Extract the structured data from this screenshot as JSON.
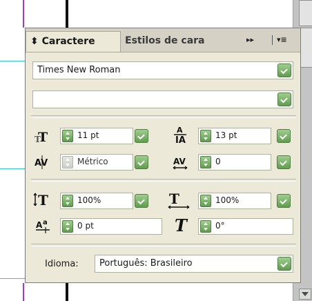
{
  "panel": {
    "tabs": [
      {
        "label": "Caractere",
        "prefix": "⬍"
      },
      {
        "label": "Estilos de cara"
      }
    ],
    "controls": {
      "forward_label": "▸▸",
      "menu_label": "▾≡"
    },
    "font_family": "Times New Roman",
    "font_style": "",
    "font_size": "11 pt",
    "leading": "13 pt",
    "kerning": "Métrico",
    "tracking": "0",
    "vertical_scale": "100%",
    "horizontal_scale": "100%",
    "baseline_shift": "0 pt",
    "skew": "0°",
    "language_label": "Idioma:",
    "language": "Português: Brasileiro"
  },
  "icons": {
    "font_size": "font-size-icon",
    "leading": "leading-icon",
    "kerning": "kerning-icon",
    "tracking": "tracking-icon",
    "vertical_scale": "vertical-scale-icon",
    "horizontal_scale": "horizontal-scale-icon",
    "baseline_shift": "baseline-shift-icon",
    "skew": "skew-icon"
  },
  "colors": {
    "panel_bg": "#ece9d8",
    "accent_green": "#6fac5c",
    "guide_cyan": "#27c9d4",
    "guide_purple": "#9b3bd6"
  }
}
